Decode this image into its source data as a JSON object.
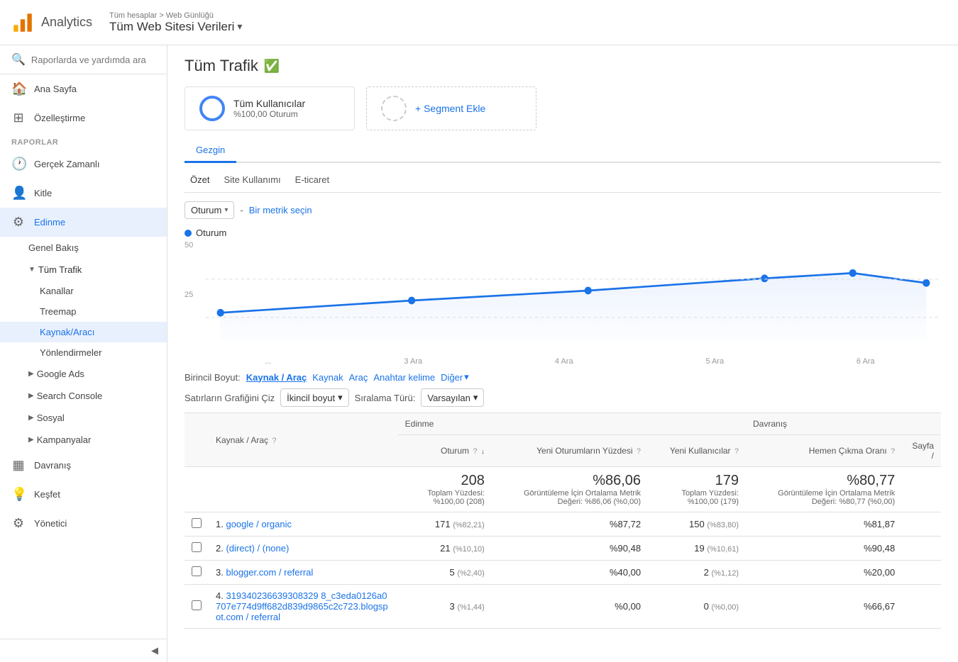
{
  "header": {
    "app_title": "Analytics",
    "breadcrumb": "Tüm hesaplar > Web Günlüğü",
    "property": "Tüm Web Sitesi Verileri"
  },
  "search": {
    "placeholder": "Raporlarda ve yardımda ara"
  },
  "sidebar": {
    "nav_items": [
      {
        "id": "ana-sayfa",
        "label": "Ana Sayfa",
        "icon": "🏠"
      },
      {
        "id": "ozellistirme",
        "label": "Özelleştirme",
        "icon": "⊞"
      }
    ],
    "section_label": "RAPORLAR",
    "report_items": [
      {
        "id": "gercek-zamanli",
        "label": "Gerçek Zamanlı",
        "icon": "🕐"
      },
      {
        "id": "kitle",
        "label": "Kitle",
        "icon": "👤"
      },
      {
        "id": "edinme",
        "label": "Edinme",
        "icon": "⚙",
        "active": true
      },
      {
        "id": "davranis",
        "label": "Davranış",
        "icon": "▦"
      },
      {
        "id": "kesif",
        "label": "Keşfet",
        "icon": "💡"
      },
      {
        "id": "yonetici",
        "label": "Yönetici",
        "icon": "⚙"
      }
    ],
    "edinme_sub": [
      {
        "id": "genel-bakis",
        "label": "Genel Bakış"
      },
      {
        "id": "tum-trafik",
        "label": "Tüm Trafik",
        "expanded": true
      },
      {
        "id": "google-ads",
        "label": "Google Ads"
      },
      {
        "id": "search-console",
        "label": "Search Console"
      },
      {
        "id": "sosyal",
        "label": "Sosyal"
      },
      {
        "id": "kampanyalar",
        "label": "Kampanyalar"
      }
    ],
    "tum_trafik_sub": [
      {
        "id": "kanallar",
        "label": "Kanallar"
      },
      {
        "id": "treemap",
        "label": "Treemap"
      },
      {
        "id": "kaynak-araci",
        "label": "Kaynak/Aracı",
        "active": true
      },
      {
        "id": "yonlendirmeler",
        "label": "Yönlendirmeler"
      }
    ]
  },
  "page": {
    "title": "Tüm Trafik",
    "verified": true
  },
  "segment": {
    "name": "Tüm Kullanıcılar",
    "pct": "%100,00 Oturum",
    "add_label": "+ Segment Ekle"
  },
  "tabs": {
    "main_tabs": [
      {
        "id": "gezgin",
        "label": "Gezgin",
        "active": true
      }
    ],
    "sub_tabs": [
      {
        "id": "ozet",
        "label": "Özet"
      },
      {
        "id": "site-kullanimi",
        "label": "Site Kullanımı"
      },
      {
        "id": "e-ticaret",
        "label": "E-ticaret"
      }
    ]
  },
  "metrics": {
    "primary_label": "Oturum",
    "separator": "-",
    "secondary_label": "Bir metrik seçin",
    "legend_label": "Oturum"
  },
  "chart": {
    "y_labels": [
      "50",
      "25"
    ],
    "x_labels": [
      "...",
      "3 Ara",
      "4 Ara",
      "5 Ara",
      "6 Ara"
    ],
    "data_points": [
      {
        "x": 0.02,
        "y": 0.72
      },
      {
        "x": 0.28,
        "y": 0.6
      },
      {
        "x": 0.52,
        "y": 0.5
      },
      {
        "x": 0.76,
        "y": 0.38
      },
      {
        "x": 0.88,
        "y": 0.32
      },
      {
        "x": 0.98,
        "y": 0.42
      }
    ]
  },
  "dimension_bar": {
    "label": "Birincil Boyut:",
    "options": [
      {
        "id": "kaynak-arac",
        "label": "Kaynak / Araç",
        "active": true
      },
      {
        "id": "kaynak",
        "label": "Kaynak"
      },
      {
        "id": "arac",
        "label": "Araç"
      },
      {
        "id": "anahtar-kelime",
        "label": "Anahtar kelime"
      },
      {
        "id": "diger",
        "label": "Diğer"
      }
    ]
  },
  "table_controls": {
    "graph_label": "Satırların Grafiğini Çiz",
    "secondary_label": "İkincil boyut",
    "sort_label": "Sıralama Türü:",
    "sort_value": "Varsayılan"
  },
  "table": {
    "group_headers": [
      {
        "id": "edinme",
        "label": "Edinme",
        "colspan": 3
      },
      {
        "id": "davranis",
        "label": "Davranış",
        "colspan": 2
      }
    ],
    "columns": [
      {
        "id": "kaynak-arac",
        "label": "Kaynak / Araç",
        "has_help": true
      },
      {
        "id": "oturum",
        "label": "Oturum",
        "has_help": true,
        "sort": true
      },
      {
        "id": "yeni-oturum-yuzde",
        "label": "Yeni Oturumların Yüzdesi",
        "has_help": true
      },
      {
        "id": "yeni-kullanici",
        "label": "Yeni Kullanıcılar",
        "has_help": true
      },
      {
        "id": "hemen-cikma",
        "label": "Hemen Çıkma Oranı",
        "has_help": true
      },
      {
        "id": "sayfa",
        "label": "Sayfa /",
        "has_help": false
      }
    ],
    "total_row": {
      "oturum": "208",
      "oturum_pct": "Toplam Yüzdesi: %100,00 (208)",
      "yeni_oturum": "%86,06",
      "yeni_oturum_sub": "Görüntüleme İçin Ortalama Metrik Değeri: %86,06 (%0,00)",
      "yeni_kullanici": "179",
      "yeni_kullanici_pct": "Toplam Yüzdesi: %100,00 (179)",
      "hemen_cikma": "%80,77",
      "hemen_cikma_sub": "Görüntüleme İçin Ortalama Metrik Değeri: %80,77 (%0,00)"
    },
    "rows": [
      {
        "num": "1.",
        "source": "google / organic",
        "oturum": "171",
        "oturum_pct": "(%82,21)",
        "yeni_oturum": "%87,72",
        "yeni_kullanici": "150",
        "yeni_kullanici_pct": "(%83,80)",
        "hemen_cikma": "%81,87"
      },
      {
        "num": "2.",
        "source": "(direct) / (none)",
        "oturum": "21",
        "oturum_pct": "(%10,10)",
        "yeni_oturum": "%90,48",
        "yeni_kullanici": "19",
        "yeni_kullanici_pct": "(%10,61)",
        "hemen_cikma": "%90,48"
      },
      {
        "num": "3.",
        "source": "blogger.com / referral",
        "oturum": "5",
        "oturum_pct": "(%2,40)",
        "yeni_oturum": "%40,00",
        "yeni_kullanici": "2",
        "yeni_kullanici_pct": "(%1,12)",
        "hemen_cikma": "%20,00"
      },
      {
        "num": "4.",
        "source": "319340236639308329 8_c3eda0126a0707e774d9ff682d839d9865c2c723.blogspot.com / referral",
        "source_full": "31934023663930832 98_c3eda0126a0707e774d9ff682d839d9865c2c723.blogspot.com / referral",
        "oturum": "3",
        "oturum_pct": "(%1,44)",
        "yeni_oturum": "%0,00",
        "yeni_kullanici": "0",
        "yeni_kullanici_pct": "(%0,00)",
        "hemen_cikma": "%66,67"
      }
    ]
  },
  "colors": {
    "blue": "#1a73e8",
    "green": "#0f9d58",
    "chart_line": "#1a73e8",
    "chart_fill": "#e8f0fe",
    "active_bg": "#e8f0fe"
  }
}
